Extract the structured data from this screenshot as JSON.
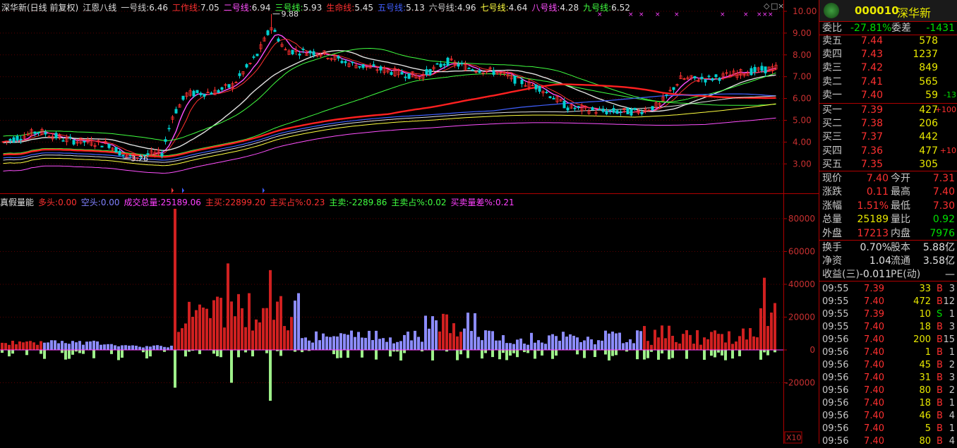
{
  "main_header": {
    "stock": "深华新(日线 前复权)",
    "indicator": "江恩八线",
    "lines": [
      {
        "label": "一号线:",
        "value": "6.46",
        "color": "#d0d0d0"
      },
      {
        "label": "工作线:",
        "value": "7.05",
        "color": "#ff3030"
      },
      {
        "label": "二号线:",
        "value": "6.94",
        "color": "#ff50ff"
      },
      {
        "label": "三号线:",
        "value": "5.93",
        "color": "#40ff40"
      },
      {
        "label": "生命线:",
        "value": "5.45",
        "color": "#ff3030"
      },
      {
        "label": "五号线:",
        "value": "5.13",
        "color": "#4060ff"
      },
      {
        "label": "六号线:",
        "value": "4.96",
        "color": "#d0d0d0"
      },
      {
        "label": "七号线:",
        "value": "4.64",
        "color": "#ffff40"
      },
      {
        "label": "八号线:",
        "value": "4.28",
        "color": "#ff50ff"
      },
      {
        "label": "九号线:",
        "value": "6.52",
        "color": "#40ff40"
      }
    ],
    "high_mark": "9.88",
    "low_mark": "3.26",
    "price_axis": [
      "10.00",
      "9.00",
      "8.00",
      "7.00",
      "6.00",
      "5.00",
      "4.00",
      "3.00"
    ]
  },
  "sub_header": {
    "title": "真假量能",
    "items": [
      {
        "label": "多头:",
        "value": "0.00",
        "color": "#ff3030"
      },
      {
        "label": "空头:",
        "value": "0.00",
        "color": "#8080ff"
      },
      {
        "label": "成交总量:",
        "value": "25189.06",
        "color": "#ff40ff"
      },
      {
        "label": "主买:",
        "value": "22899.20",
        "color": "#ff3030"
      },
      {
        "label": "主买占%:",
        "value": "0.23",
        "color": "#ff3030"
      },
      {
        "label": "主卖:",
        "value": "-2289.86",
        "color": "#40ff40"
      },
      {
        "label": "主卖占%:",
        "value": "0.02",
        "color": "#40ff40"
      },
      {
        "label": "买卖量差%:",
        "value": "0.21",
        "color": "#ff40ff"
      }
    ],
    "vol_axis": [
      "80000",
      "60000",
      "40000",
      "20000",
      "0",
      "-20000"
    ],
    "zoom_label": "X10"
  },
  "panel": {
    "code": "000010",
    "name": "深华新",
    "webi": {
      "label1": "委比",
      "value1": "-27.81%",
      "label2": "委差",
      "value2": "-1431"
    },
    "asks": [
      {
        "label": "卖五",
        "price": "7.44",
        "vol": "578",
        "chg": ""
      },
      {
        "label": "卖四",
        "price": "7.43",
        "vol": "1237",
        "chg": ""
      },
      {
        "label": "卖三",
        "price": "7.42",
        "vol": "849",
        "chg": ""
      },
      {
        "label": "卖二",
        "price": "7.41",
        "vol": "565",
        "chg": ""
      },
      {
        "label": "卖一",
        "price": "7.40",
        "vol": "59",
        "chg": "-13"
      }
    ],
    "bids": [
      {
        "label": "买一",
        "price": "7.39",
        "vol": "427",
        "chg": "+100"
      },
      {
        "label": "买二",
        "price": "7.38",
        "vol": "206",
        "chg": ""
      },
      {
        "label": "买三",
        "price": "7.37",
        "vol": "442",
        "chg": ""
      },
      {
        "label": "买四",
        "price": "7.36",
        "vol": "477",
        "chg": "+10"
      },
      {
        "label": "买五",
        "price": "7.35",
        "vol": "305",
        "chg": ""
      }
    ],
    "stats": [
      {
        "l1": "现价",
        "v1": "7.40",
        "c1": "red",
        "l2": "今开",
        "v2": "7.31",
        "c2": "red"
      },
      {
        "l1": "涨跌",
        "v1": "0.11",
        "c1": "red",
        "l2": "最高",
        "v2": "7.40",
        "c2": "red"
      },
      {
        "l1": "涨幅",
        "v1": "1.51%",
        "c1": "red",
        "l2": "最低",
        "v2": "7.30",
        "c2": "red"
      },
      {
        "l1": "总量",
        "v1": "25189",
        "c1": "yellow",
        "l2": "量比",
        "v2": "0.92",
        "c2": "green"
      },
      {
        "l1": "外盘",
        "v1": "17213",
        "c1": "red",
        "l2": "内盘",
        "v2": "7976",
        "c2": "green"
      }
    ],
    "stats2": [
      {
        "l1": "换手",
        "v1": "0.70%",
        "l2": "股本",
        "v2": "5.88亿"
      },
      {
        "l1": "净资",
        "v1": "1.04",
        "l2": "流通",
        "v2": "3.58亿"
      },
      {
        "l1": "收益(三)",
        "v1": "-0.011",
        "l2": "PE(动)",
        "v2": "—"
      }
    ],
    "ticks": [
      {
        "time": "09:55",
        "price": "7.39",
        "vol": "33",
        "side": "B",
        "num": "3"
      },
      {
        "time": "09:55",
        "price": "7.40",
        "vol": "472",
        "side": "B",
        "num": "12"
      },
      {
        "time": "09:55",
        "price": "7.39",
        "vol": "10",
        "side": "S",
        "num": "1"
      },
      {
        "time": "09:55",
        "price": "7.40",
        "vol": "18",
        "side": "B",
        "num": "3"
      },
      {
        "time": "09:56",
        "price": "7.40",
        "vol": "200",
        "side": "B",
        "num": "15"
      },
      {
        "time": "09:56",
        "price": "7.40",
        "vol": "1",
        "side": "B",
        "num": "1"
      },
      {
        "time": "09:56",
        "price": "7.40",
        "vol": "45",
        "side": "B",
        "num": "2"
      },
      {
        "time": "09:56",
        "price": "7.40",
        "vol": "31",
        "side": "B",
        "num": "3"
      },
      {
        "time": "09:56",
        "price": "7.40",
        "vol": "80",
        "side": "B",
        "num": "2"
      },
      {
        "time": "09:56",
        "price": "7.40",
        "vol": "18",
        "side": "B",
        "num": "1"
      },
      {
        "time": "09:56",
        "price": "7.40",
        "vol": "46",
        "side": "B",
        "num": "4"
      },
      {
        "time": "09:56",
        "price": "7.40",
        "vol": "5",
        "side": "B",
        "num": "1"
      },
      {
        "time": "09:56",
        "price": "7.40",
        "vol": "80",
        "side": "B",
        "num": "4"
      }
    ]
  },
  "colors": {
    "axis": "#b00000",
    "up": "#ff3030",
    "down": "#00d0d0",
    "vol_red": "#d02020",
    "vol_blue": "#8c8cff",
    "vol_green": "#9ef08a"
  }
}
